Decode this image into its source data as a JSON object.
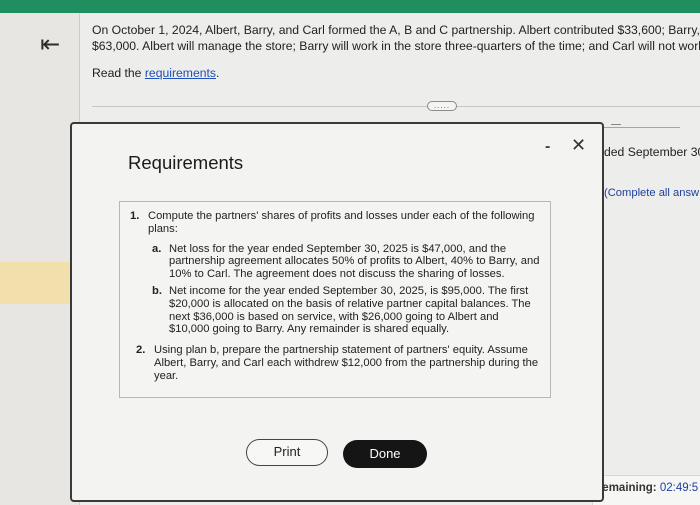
{
  "header": {
    "back_icon": "back-arrow-icon"
  },
  "question": {
    "line1": "On October 1, 2024, Albert, Barry, and Carl formed the A, B and C partnership. Albert contributed $33,600; Barry, $",
    "line2": "$63,000. Albert will manage the store; Barry will work in the store three-quarters of the time; and Carl will not work in",
    "read_prefix": "Read the ",
    "read_link": "requirements",
    "read_suffix": ".",
    "more_label": "....."
  },
  "background_right": {
    "period_text": "ded September 30",
    "instruction": "(Complete all answ",
    "remaining_label": "Remaining:",
    "remaining_time": "02:49:5"
  },
  "modal": {
    "title": "Requirements",
    "minimize_label": "-",
    "close_label": "✕",
    "requirements": {
      "item1_num": "1.",
      "item1_text": "Compute the partners' shares of profits and losses under each of the following plans:",
      "a_label": "a.",
      "a_text": "Net loss for the year ended September 30, 2025 is $47,000, and the partnership agreement allocates 50% of profits to Albert, 40% to Barry, and 10% to Carl. The agreement does not discuss the sharing of losses.",
      "b_label": "b.",
      "b_text": "Net income for the year ended September 30, 2025, is $95,000. The first $20,000 is allocated on the basis of relative partner capital balances. The next $36,000 is based on service, with $26,000 going to Albert and $10,000 going to Barry. Any remainder is shared equally.",
      "item2_num": "2.",
      "item2_text": "Using plan b, prepare the partnership statement of partners' equity. Assume Albert, Barry, and Carl each withdrew $12,000 from the partnership during the year."
    },
    "print_label": "Print",
    "done_label": "Done"
  },
  "colors": {
    "top_bar": "#1f8f5f",
    "link": "#1f4fb8",
    "done_button": "#151515",
    "gold_band": "#f1e0ab"
  }
}
